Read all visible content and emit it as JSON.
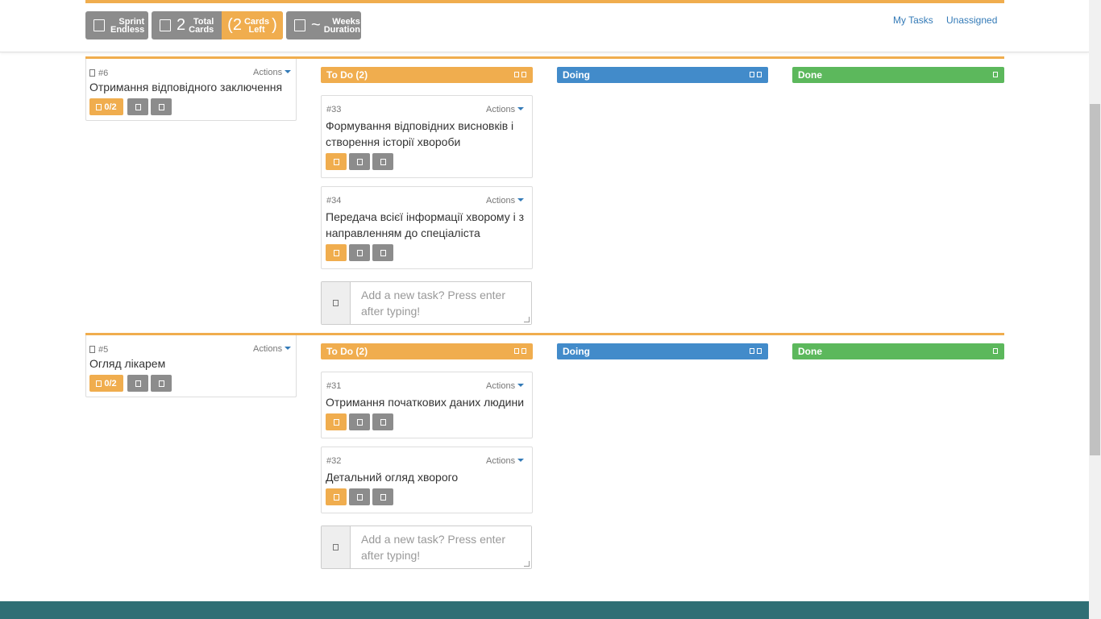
{
  "header": {
    "sprint": {
      "icon": "calendar-icon",
      "line1": "Sprint",
      "line2": "Endless"
    },
    "total": {
      "icon": "cards-icon",
      "count": "2",
      "line1": "Total",
      "line2": "Cards"
    },
    "left": {
      "count": "2",
      "line1": "Cards",
      "line2": "Left",
      "open": "(",
      "close": ")"
    },
    "weeks": {
      "icon": "clock-icon",
      "value": "~",
      "line1": "Weeks",
      "line2": "Duration"
    },
    "links": {
      "my_tasks": "My Tasks",
      "unassigned": "Unassigned"
    }
  },
  "columns": {
    "todo": "To Do (2)",
    "doing": "Doing",
    "done": "Done"
  },
  "actions_label": "Actions",
  "add_task_placeholder": "Add a new task? Press enter after typing!",
  "lanes": [
    {
      "story": {
        "number": "#6",
        "title": "Отримання відповідного заключення",
        "progress": "0/2"
      },
      "tasks": [
        {
          "number": "#33",
          "title": "Формування відповідних висновків і створення історії хвороби"
        },
        {
          "number": "#34",
          "title": "Передача всієї інформації хворому і з направленням до спеціаліста"
        }
      ]
    },
    {
      "story": {
        "number": "#5",
        "title": "Огляд лікарем",
        "progress": "0/2"
      },
      "tasks": [
        {
          "number": "#31",
          "title": "Отримання початкових даних людини"
        },
        {
          "number": "#32",
          "title": "Детальний огляд хворого"
        }
      ]
    }
  ],
  "colors": {
    "accent": "#f0ad4e",
    "doing": "#428bca",
    "done": "#5cb85c",
    "gray": "#8c8c8c",
    "footer": "#2f6f75"
  }
}
